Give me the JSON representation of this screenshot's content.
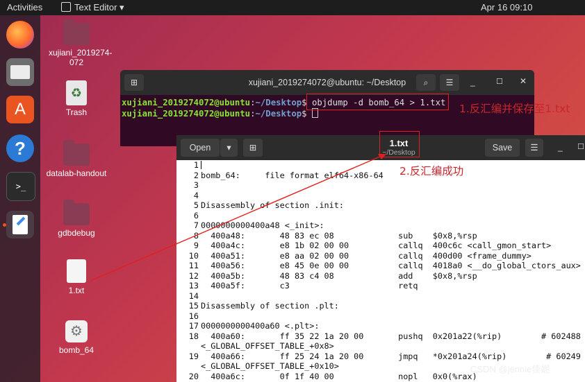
{
  "topbar": {
    "activities": "Activities",
    "app": "Text Editor",
    "app_caret": "▾",
    "clock": "Apr 16  09:10"
  },
  "desktop": {
    "icons": [
      {
        "label": "xujiani_2019274-072"
      },
      {
        "label": "Trash"
      },
      {
        "label": "datalab-handout"
      },
      {
        "label": "gdbdebug"
      },
      {
        "label": "1.txt"
      },
      {
        "label": "bomb_64"
      }
    ]
  },
  "terminal": {
    "title": "xujiani_2019274072@ubuntu: ~/Desktop",
    "lines": [
      {
        "user": "xujiani_2019274072@ubuntu",
        "path": "~/Desktop",
        "cmd": "objdump -d bomb_64 > 1.txt"
      },
      {
        "user": "xujiani_2019274072@ubuntu",
        "path": "~/Desktop",
        "cmd": ""
      }
    ]
  },
  "editor": {
    "open_label": "Open",
    "filename": "1.txt",
    "path": "~/Desktop",
    "save_label": "Save",
    "lines": [
      {
        "n": "1",
        "t": ""
      },
      {
        "n": "2",
        "t": "bomb_64:     file format elf64-x86-64"
      },
      {
        "n": "3",
        "t": ""
      },
      {
        "n": "4",
        "t": ""
      },
      {
        "n": "5",
        "t": "Disassembly of section .init:"
      },
      {
        "n": "6",
        "t": ""
      },
      {
        "n": "7",
        "t": "0000000000400a48 <_init>:"
      },
      {
        "n": "8",
        "t": "  400a48:       48 83 ec 08             sub    $0x8,%rsp"
      },
      {
        "n": "9",
        "t": "  400a4c:       e8 1b 02 00 00          callq  400c6c <call_gmon_start>"
      },
      {
        "n": "10",
        "t": "  400a51:       e8 aa 02 00 00          callq  400d00 <frame_dummy>"
      },
      {
        "n": "11",
        "t": "  400a56:       e8 45 0e 00 00          callq  4018a0 <__do_global_ctors_aux>"
      },
      {
        "n": "12",
        "t": "  400a5b:       48 83 c4 08             add    $0x8,%rsp"
      },
      {
        "n": "13",
        "t": "  400a5f:       c3                      retq"
      },
      {
        "n": "14",
        "t": ""
      },
      {
        "n": "15",
        "t": "Disassembly of section .plt:"
      },
      {
        "n": "16",
        "t": ""
      },
      {
        "n": "17",
        "t": "0000000000400a60 <.plt>:"
      },
      {
        "n": "18",
        "t": "  400a60:       ff 35 22 1a 20 00       pushq  0x201a22(%rip)        # 602488"
      },
      {
        "n": "",
        "t": "<_GLOBAL_OFFSET_TABLE_+0x8>"
      },
      {
        "n": "19",
        "t": "  400a66:       ff 25 24 1a 20 00       jmpq   *0x201a24(%rip)        # 60249"
      },
      {
        "n": "",
        "t": "<_GLOBAL_OFFSET_TABLE_+0x10>"
      },
      {
        "n": "20",
        "t": "  400a6c:       0f 1f 40 00             nopl   0x0(%rax)"
      }
    ]
  },
  "annotations": {
    "a1": "1.反汇编并保存至1.txt",
    "a2": "2.反汇编成功"
  },
  "watermark": "CSDN @jennie佳妮",
  "colors": {
    "prompt_user": "#8ae234",
    "prompt_path": "#729fcf",
    "terminal_bg": "#300a24",
    "annotation": "#c8262d"
  }
}
